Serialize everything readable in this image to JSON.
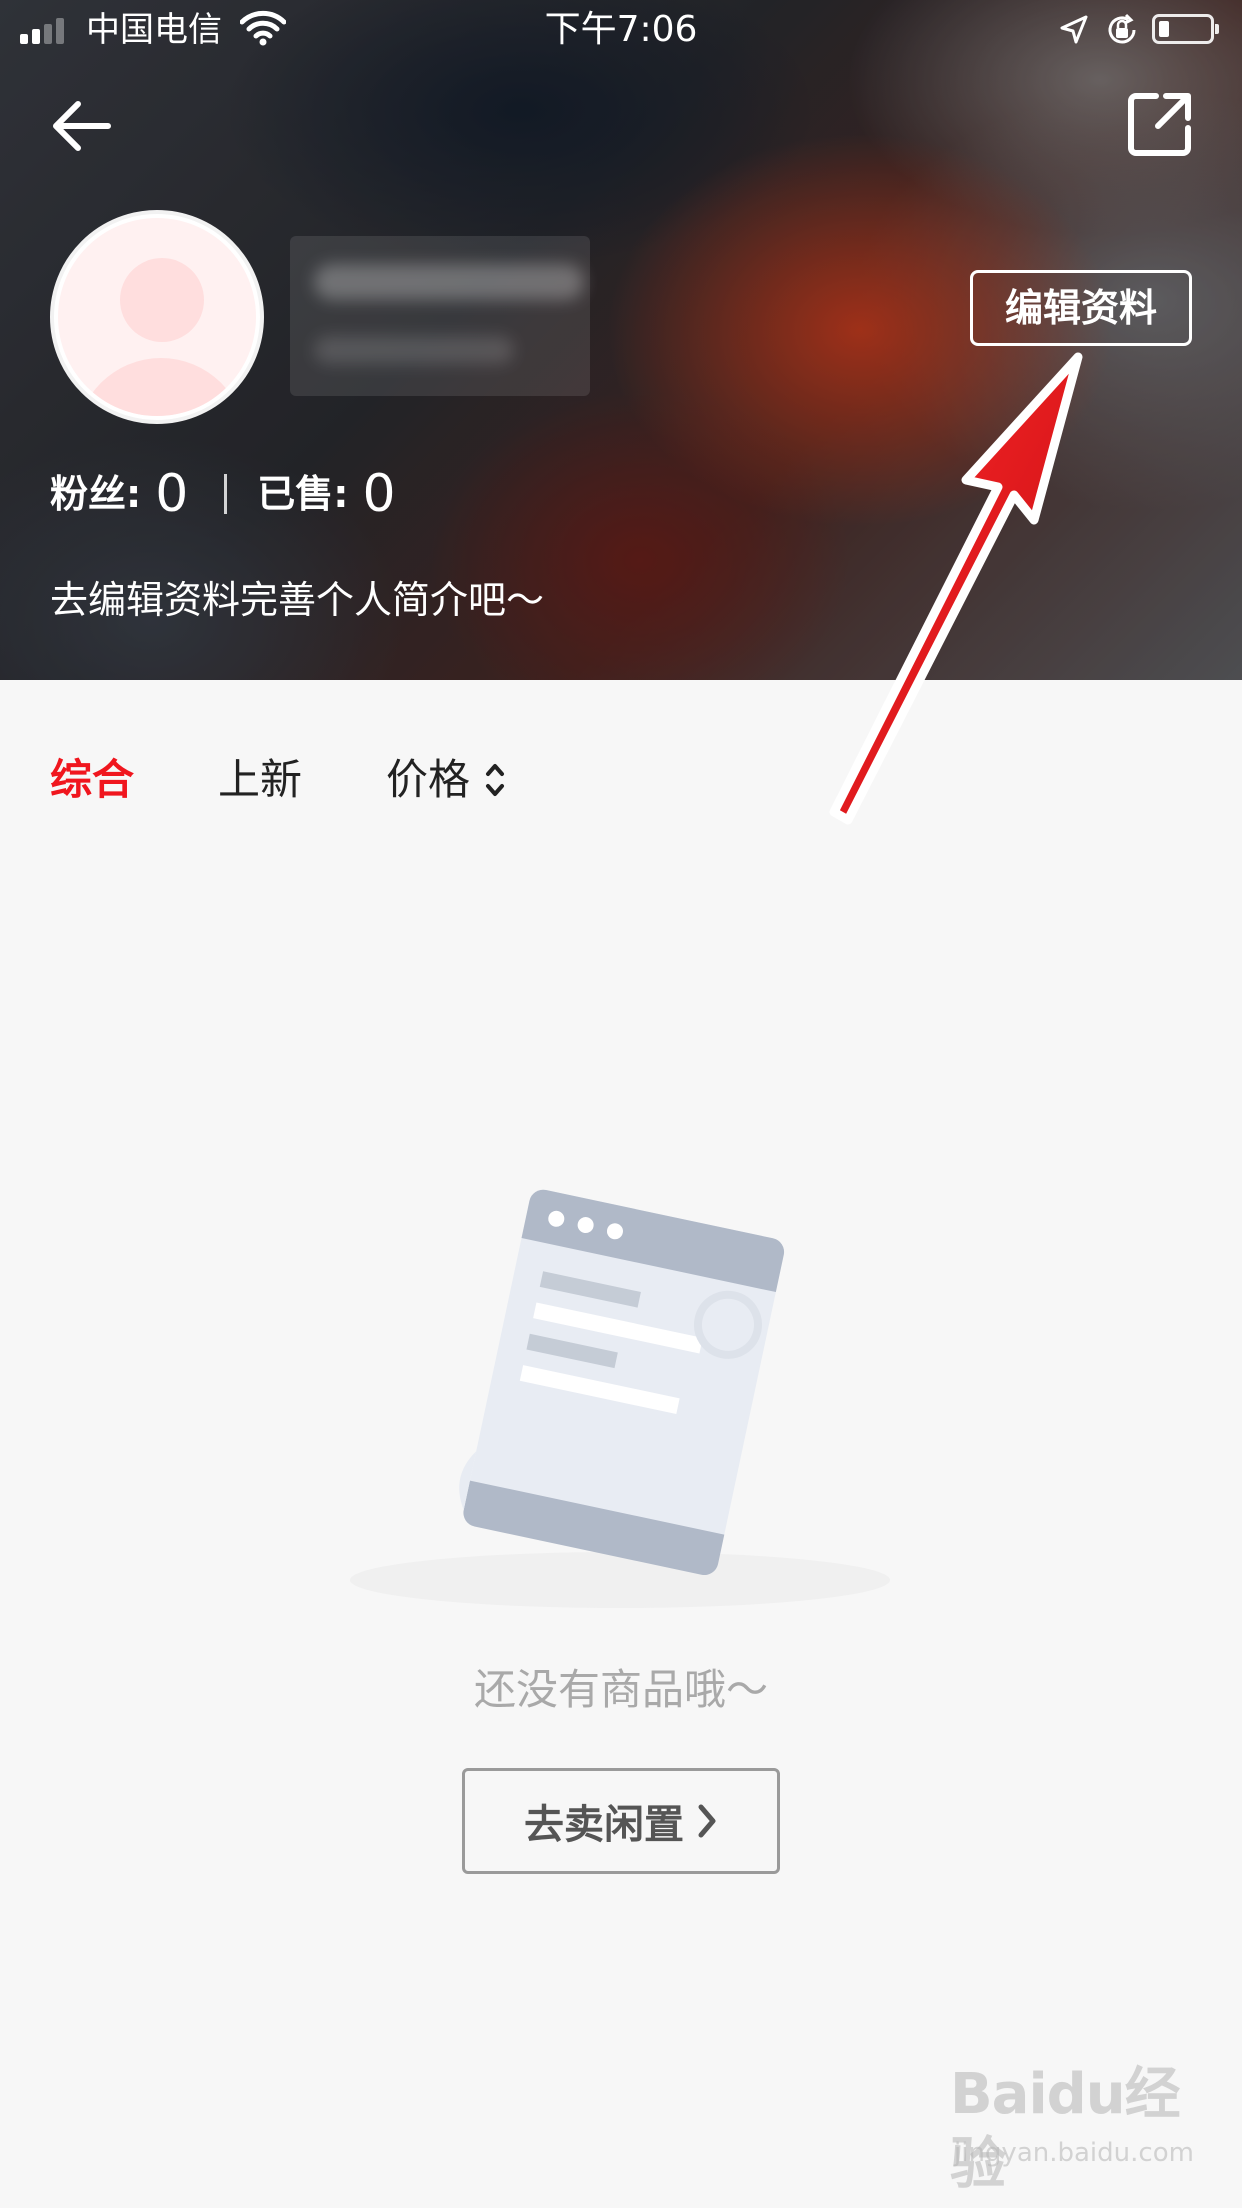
{
  "status_bar": {
    "carrier": "中国电信",
    "time": "下午7:06",
    "battery_level": 0.2
  },
  "header": {
    "back_icon": "arrow-left-icon",
    "share_icon": "external-share-icon"
  },
  "profile": {
    "edit_button_label": "编辑资料",
    "stats": {
      "followers_label": "粉丝:",
      "followers_value": "0",
      "sold_label": "已售:",
      "sold_value": "0"
    },
    "bio": "去编辑资料完善个人简介吧～"
  },
  "tabs": [
    {
      "label": "综合",
      "active": true
    },
    {
      "label": "上新",
      "active": false
    },
    {
      "label": "价格",
      "active": false
    }
  ],
  "empty_state": {
    "illustration": "document-icon",
    "message": "还没有商品哦～",
    "button_label": "去卖闲置"
  },
  "annotation": {
    "color": "#e8141b"
  },
  "watermark": {
    "logo": "Baidu经验",
    "url": "jingyan.baidu.com"
  },
  "colors": {
    "accent": "#f0161e",
    "background": "#f7f7f7",
    "muted_text": "#a9a9a9"
  }
}
